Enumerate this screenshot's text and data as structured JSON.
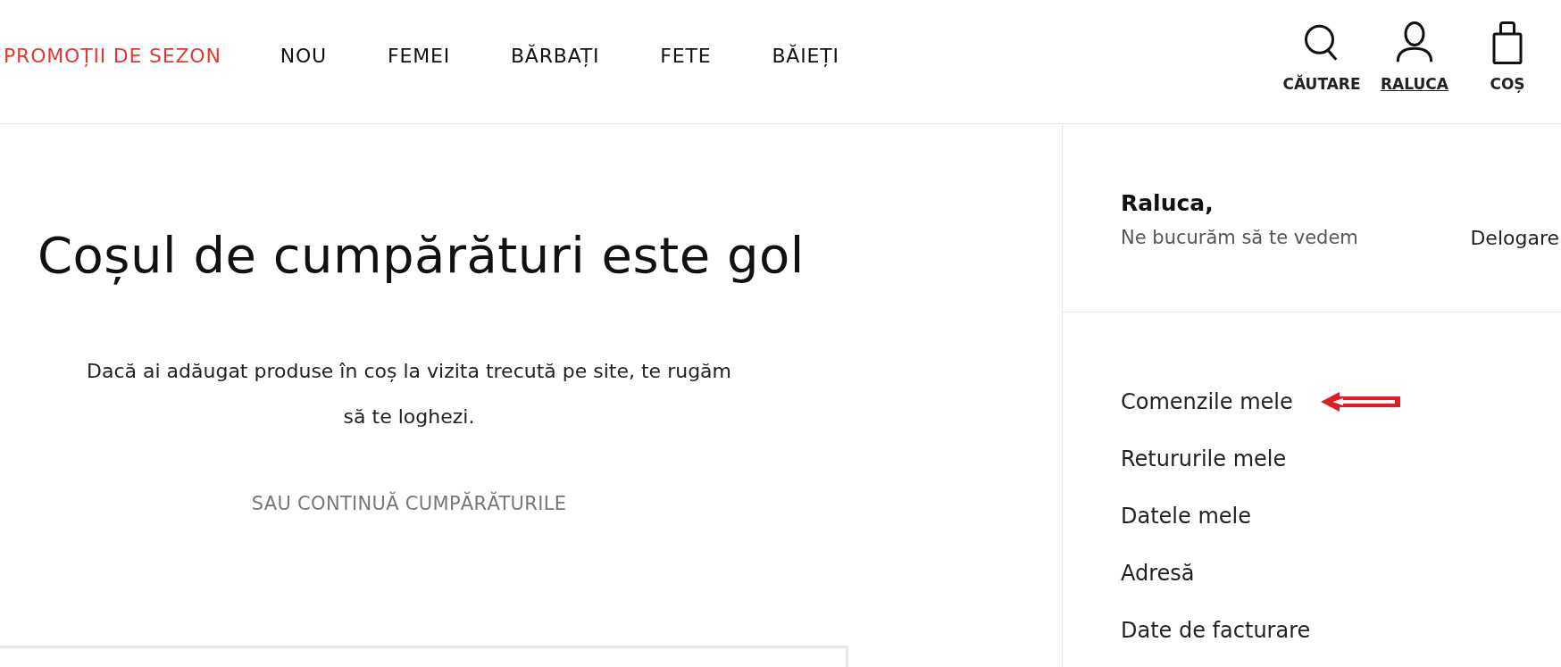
{
  "nav": {
    "items": [
      {
        "label": "PROMOȚII DE SEZON",
        "kind": "promo"
      },
      {
        "label": "NOU",
        "kind": "normal"
      },
      {
        "label": "FEMEI",
        "kind": "normal"
      },
      {
        "label": "BĂRBAȚI",
        "kind": "normal"
      },
      {
        "label": "FETE",
        "kind": "normal"
      },
      {
        "label": "BĂIEȚI",
        "kind": "normal"
      }
    ],
    "actions": [
      {
        "label": "CĂUTARE",
        "kind": "search",
        "selected": false
      },
      {
        "label": "RALUCA",
        "kind": "account",
        "selected": true
      },
      {
        "label": "COȘ",
        "kind": "bag",
        "selected": false
      }
    ]
  },
  "cart": {
    "title": "Coșul de cumpărături este gol",
    "message": "Dacă ai adăugat produse în coș la vizita trecută pe site, te rugăm să te loghezi.",
    "continue_link": "SAU CONTINUĂ CUMPĂRĂTURILE"
  },
  "account": {
    "greeting": "Raluca,",
    "subtitle": "Ne bucurăm să te vedem",
    "logout": "Delogare",
    "menu": [
      {
        "label": "Comenzile mele",
        "highlighted": true
      },
      {
        "label": "Retururile mele",
        "highlighted": false
      },
      {
        "label": "Datele mele",
        "highlighted": false
      },
      {
        "label": "Adresă",
        "highlighted": false
      },
      {
        "label": "Date de facturare",
        "highlighted": false
      }
    ]
  }
}
